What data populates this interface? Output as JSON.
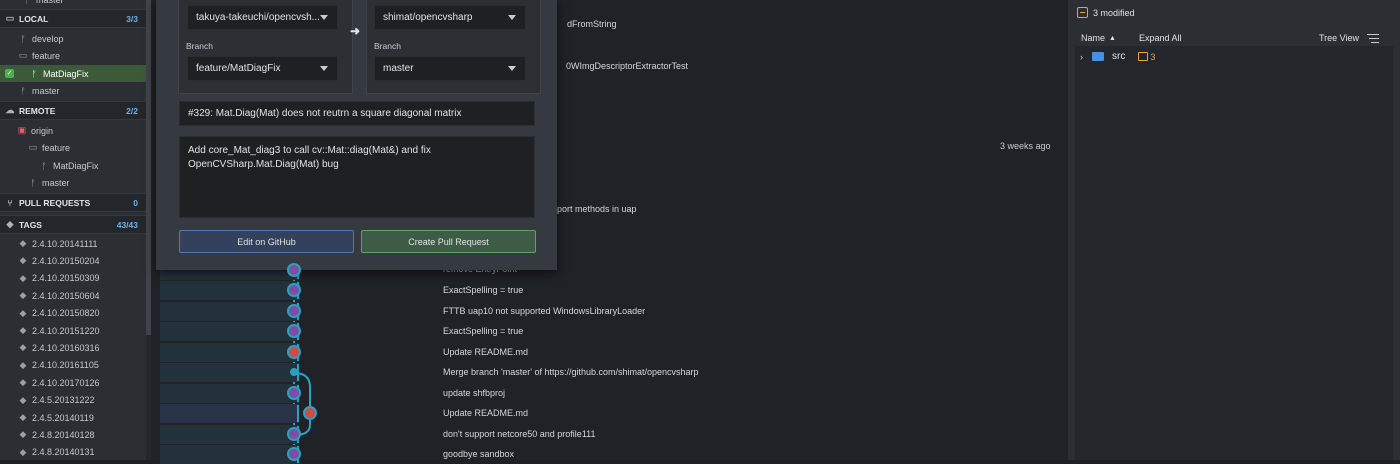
{
  "sidebar": {
    "top_item": "master",
    "local": {
      "label": "LOCAL",
      "count": "3/3",
      "items": [
        "develop",
        "feature",
        "MatDiagFix",
        "master"
      ]
    },
    "remote": {
      "label": "REMOTE",
      "count": "2/2",
      "origin": "origin",
      "feature": "feature",
      "matdiag": "MatDiagFix",
      "master": "master"
    },
    "pull_requests": {
      "label": "PULL REQUESTS",
      "count": "0"
    },
    "tags": {
      "label": "TAGS",
      "count": "43/43",
      "items": [
        "2.4.10.20141111",
        "2.4.10.20150204",
        "2.4.10.20150309",
        "2.4.10.20150604",
        "2.4.10.20150820",
        "2.4.10.20151220",
        "2.4.10.20160316",
        "2.4.10.20161105",
        "2.4.10.20170126",
        "2.4.5.20131222",
        "2.4.5.20140119",
        "2.4.8.20140128",
        "2.4.8.20140131"
      ]
    }
  },
  "modal": {
    "from_repo": "takuya-takeuchi/opencvsh...",
    "to_repo": "shimat/opencvsharp",
    "branch_label_left": "Branch",
    "branch_label_right": "Branch",
    "from_branch": "feature/MatDiagFix",
    "to_branch": "master",
    "title": "#329: Mat.Diag(Mat) does not reutrn a square diagonal matrix",
    "body": "Add core_Mat_diag3 to call cv::Mat::diag(Mat&) and fix OpenCVSharp.Mat.Diag(Mat) bug",
    "edit_button": "Edit on GitHub",
    "create_button": "Create Pull Request"
  },
  "graph": {
    "partial_1": "dFromString",
    "partial_2": "0WImgDescriptorExtractorTest",
    "time": "3 weeks ago",
    "partial_3": "port methods in uap",
    "partial_4": "remove EntryPoint",
    "commits": [
      "ExactSpelling = true",
      "FTTB uap10 not supported WindowsLibraryLoader",
      "ExactSpelling = true",
      "Update README.md",
      "Merge branch 'master' of https://github.com/shimat/opencvsharp",
      "update shfbproj",
      "Update README.md",
      "don't support netcore50 and profile111",
      "goodbye sandbox"
    ]
  },
  "right": {
    "modified": "3 modified",
    "col_name": "Name",
    "expand_all": "Expand All",
    "tree_view": "Tree View",
    "folder": "src",
    "folder_count": "3"
  }
}
